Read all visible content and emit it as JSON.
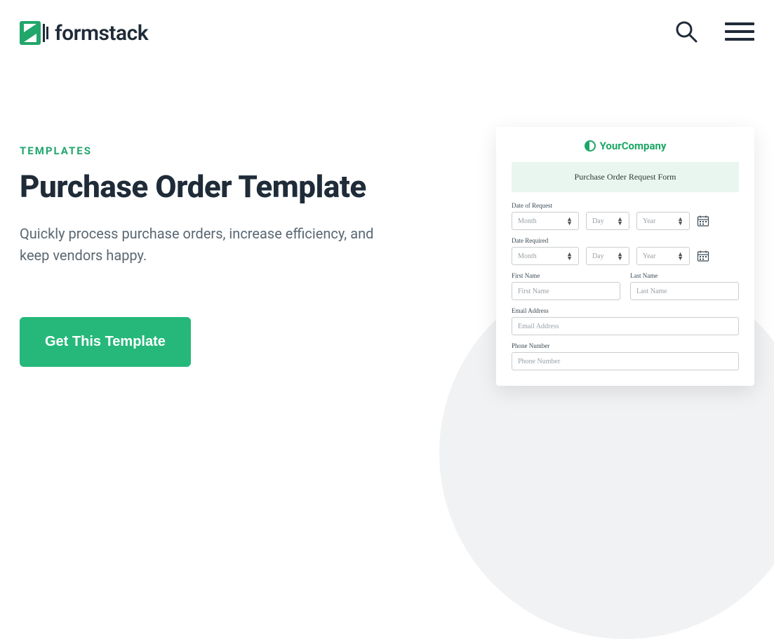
{
  "header": {
    "brand": "formstack"
  },
  "hero": {
    "eyebrow": "TEMPLATES",
    "title": "Purchase Order Template",
    "description": "Quickly process purchase orders, increase efficiency, and keep vendors happy.",
    "cta_label": "Get This Template"
  },
  "preview": {
    "company_name": "YourCompany",
    "banner": "Purchase Order Request Form",
    "date_of_request_label": "Date of Request",
    "date_required_label": "Date Required",
    "select_month": "Month",
    "select_day": "Day",
    "select_year": "Year",
    "first_name_label": "First Name",
    "first_name_placeholder": "First Name",
    "last_name_label": "Last Name",
    "last_name_placeholder": "Last Name",
    "email_label": "Email Address",
    "email_placeholder": "Email Address",
    "phone_label": "Phone Number",
    "phone_placeholder": "Phone Number"
  }
}
